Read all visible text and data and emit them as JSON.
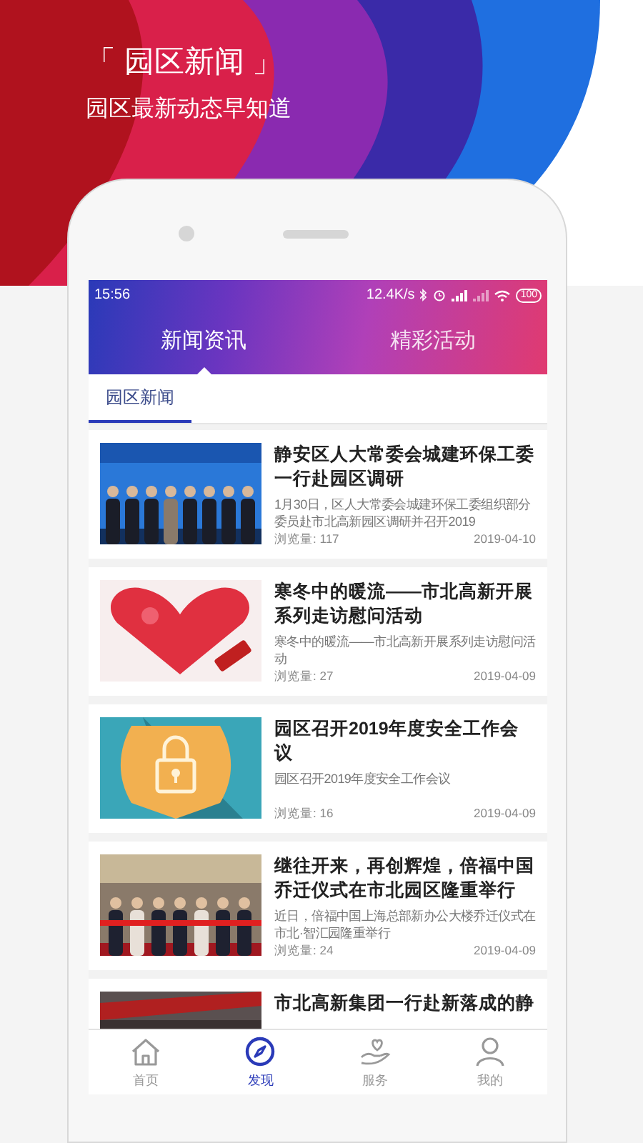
{
  "header": {
    "title": "「 园区新闻 」",
    "subtitle": "园区最新动态早知道"
  },
  "status_bar": {
    "time": "15:56",
    "speed": "12.4K/s",
    "battery": "100"
  },
  "tabs": [
    {
      "label": "新闻资讯",
      "selected": true
    },
    {
      "label": "精彩活动",
      "selected": false
    }
  ],
  "subtabs": [
    {
      "label": "园区新闻",
      "selected": true
    }
  ],
  "articles": [
    {
      "title": "静安区人大常委会城建环保工委一行赴园区调研",
      "summary": "1月30日，区人大常委会城建环保工委组织部分委员赴市北高新园区调研并召开2019",
      "views": "浏览量: 117",
      "date": "2019-04-10"
    },
    {
      "title": "寒冬中的暖流——市北高新开展系列走访慰问活动",
      "summary": "寒冬中的暖流——市北高新开展系列走访慰问活动",
      "views": "浏览量: 27",
      "date": "2019-04-09"
    },
    {
      "title": "园区召开2019年度安全工作会议",
      "summary": "园区召开2019年度安全工作会议",
      "views": "浏览量: 16",
      "date": "2019-04-09"
    },
    {
      "title": "继往开来，再创辉煌，倍福中国乔迁仪式在市北园区隆重举行",
      "summary": "近日，倍福中国上海总部新办公大楼乔迁仪式在市北·智汇园隆重举行",
      "views": "浏览量: 24",
      "date": "2019-04-09"
    },
    {
      "title": "市北高新集团一行赴新落成的静"
    }
  ],
  "nav": [
    {
      "label": "首页",
      "kind": "home",
      "selected": false
    },
    {
      "label": "发现",
      "kind": "compass",
      "selected": true
    },
    {
      "label": "服务",
      "kind": "care",
      "selected": false
    },
    {
      "label": "我的",
      "kind": "person",
      "selected": false
    }
  ]
}
